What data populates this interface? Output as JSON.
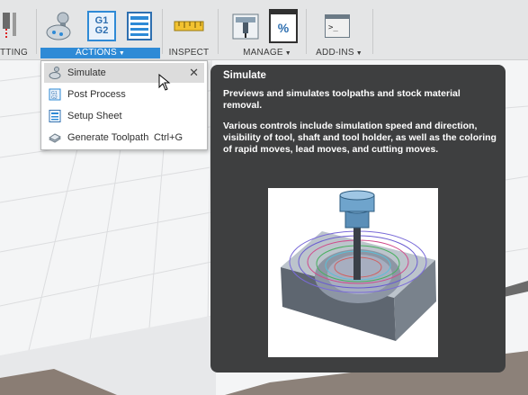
{
  "toolbar": {
    "partial_label": "TTING",
    "actions_label": "ACTIONS",
    "inspect_label": "INSPECT",
    "manage_label": "MANAGE",
    "addins_label": "ADD-INS",
    "gcode_icon_text_1": "G1",
    "gcode_icon_text_2": "G2",
    "percent_icon_text": "%",
    "terminal_icon_text": ">_"
  },
  "menu": {
    "items": [
      {
        "label": "Simulate",
        "icon": "simulate-icon",
        "highlighted": true
      },
      {
        "label": "Post Process",
        "icon": "post-process-icon"
      },
      {
        "label": "Setup Sheet",
        "icon": "setup-sheet-icon"
      },
      {
        "label": "Generate Toolpath",
        "icon": "generate-toolpath-icon",
        "shortcut": "Ctrl+G"
      }
    ],
    "close_glyph": "✕"
  },
  "tooltip": {
    "title": "Simulate",
    "para1": "Previews and simulates toolpaths and stock material removal.",
    "para2": "Various controls include simulation speed and direction, visibility of tool, shaft and tool holder, as well as the coloring of rapid moves, lead moves, and cutting moves."
  },
  "colors": {
    "accent": "#2e8ad6",
    "tooltip_bg": "#3e3f40",
    "toolbar_bg": "#e4e5e6"
  }
}
